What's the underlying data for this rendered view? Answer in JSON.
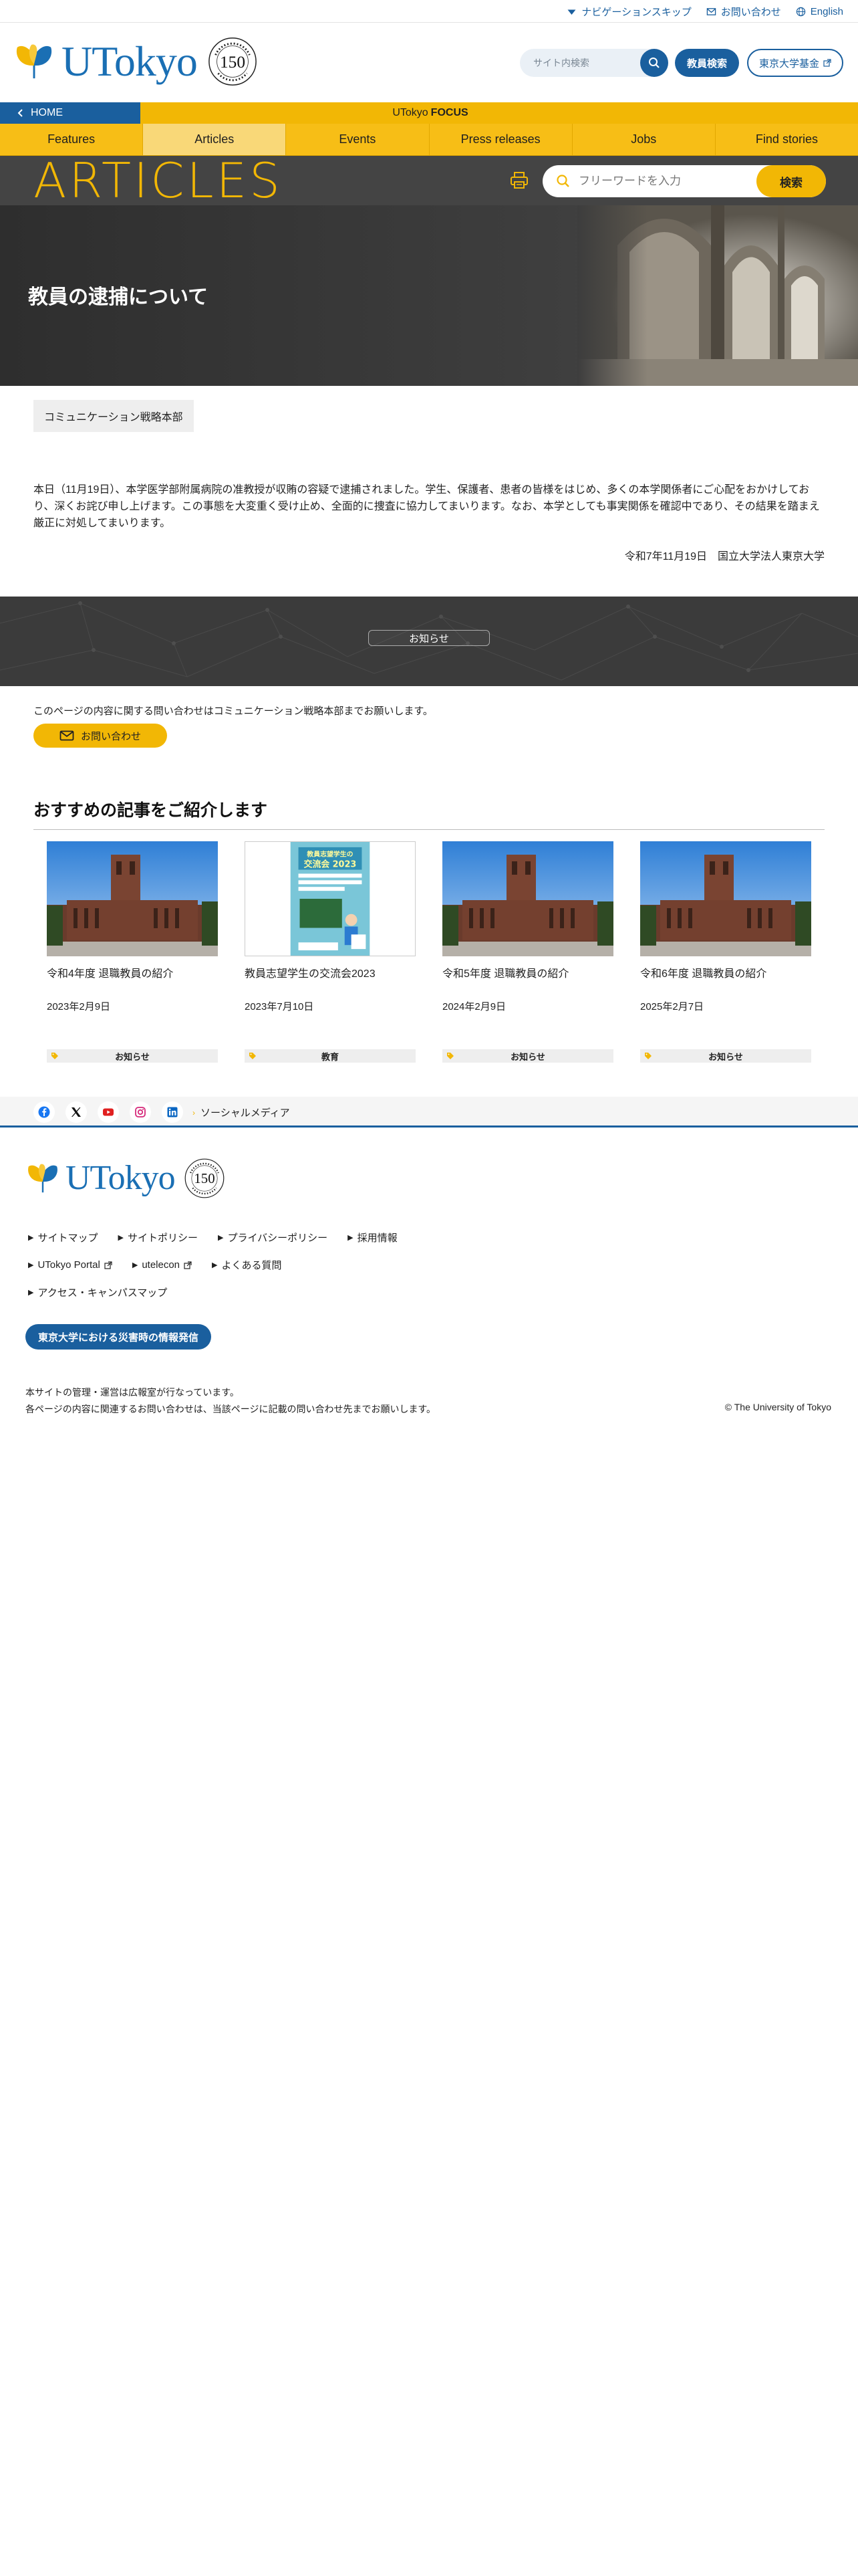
{
  "utility": {
    "skip_nav": "ナビゲーションスキップ",
    "contact": "お問い合わせ",
    "english": "English"
  },
  "header": {
    "logo_text": "UTokyo",
    "search_placeholder": "サイト内検索",
    "faculty_search": "教員検索",
    "fund": "東京大学基金"
  },
  "focus_bar": {
    "home": "HOME",
    "label_prefix": "UTokyo",
    "label_bold": "FOCUS"
  },
  "nav": {
    "items": [
      "Features",
      "Articles",
      "Events",
      "Press releases",
      "Jobs",
      "Find stories"
    ],
    "active": "Articles"
  },
  "articles_band": {
    "title": "ARTICLES",
    "search_placeholder": "フリーワードを入力",
    "search_button": "検索"
  },
  "hero": {
    "title": "教員の逮捕について"
  },
  "article": {
    "department": "コミュニケーション戦略本部",
    "body": "本日（11月19日）、本学医学部附属病院の准教授が収賄の容疑で逮捕されました。学生、保護者、患者の皆様をはじめ、多くの本学関係者にご心配をおかけしており、深くお詫び申し上げます。この事態を大変重く受け止め、全面的に捜査に協力してまいります。なお、本学としても事実関係を確認中であり、その結果を踏まえ厳正に対処してまいります。",
    "signature": "令和7年11月19日　国立大学法人東京大学"
  },
  "notice": {
    "label": "お知らせ"
  },
  "inquiry": {
    "text": "このページの内容に関する問い合わせはコミュニケーション戦略本部までお願いします。",
    "button": "お問い合わせ"
  },
  "recommended": {
    "heading": "おすすめの記事をご紹介します",
    "cards": [
      {
        "title": "令和4年度 退職教員の紹介",
        "date": "2023年2月9日",
        "tag": "お知らせ",
        "image": "yasuda-auditorium"
      },
      {
        "title": "教員志望学生の交流会2023",
        "date": "2023年7月10日",
        "tag": "教育",
        "image": "poster",
        "poster_line1": "教員志望学生の",
        "poster_line2": "交流会 2023"
      },
      {
        "title": "令和5年度 退職教員の紹介",
        "date": "2024年2月9日",
        "tag": "お知らせ",
        "image": "yasuda-auditorium"
      },
      {
        "title": "令和6年度 退職教員の紹介",
        "date": "2025年2月7日",
        "tag": "お知らせ",
        "image": "yasuda-auditorium"
      }
    ]
  },
  "social": {
    "label": "ソーシャルメディア",
    "icons": [
      "facebook-icon",
      "x-icon",
      "youtube-icon",
      "instagram-icon",
      "linkedin-icon"
    ]
  },
  "footer": {
    "row1": [
      "サイトマップ",
      "サイトポリシー",
      "プライバシーポリシー",
      "採用情報"
    ],
    "row2": [
      "UTokyo Portal",
      "utelecon",
      "よくある質問"
    ],
    "row3": [
      "アクセス・キャンパスマップ"
    ],
    "disaster_button": "東京大学における災害時の情報発信",
    "note_line1": "本サイトの管理・運営は広報室が行なっています。",
    "note_line2": "各ページの内容に関連するお問い合わせは、当該ページに記載の問い合わせ先までお願いします。",
    "copyright": "© The University of Tokyo"
  },
  "colors": {
    "brand_blue": "#1a5f9e",
    "brand_yellow": "#f2b705",
    "dark_band": "#3b3b3b"
  }
}
